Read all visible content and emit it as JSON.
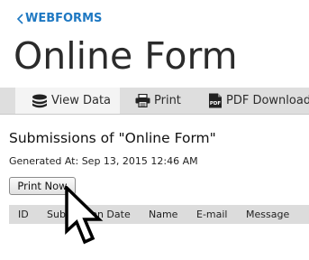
{
  "header": {
    "back_label": "WEBFORMS",
    "title": "Online Form"
  },
  "tabs": [
    {
      "label": "View Data",
      "icon": "database-icon",
      "active": true
    },
    {
      "label": "Print",
      "icon": "printer-icon",
      "active": false
    },
    {
      "label": "PDF Download",
      "icon": "pdf-icon",
      "active": false
    }
  ],
  "content": {
    "title": "Submissions of \"Online Form\"",
    "generated": "Generated At: Sep 13, 2015 12:46 AM",
    "print_button": "Print Now"
  },
  "table": {
    "columns": [
      "ID",
      "Submission Date",
      "Name",
      "E-mail",
      "Message"
    ]
  },
  "colors": {
    "accent": "#1e78c2",
    "tab_bar": "#dedede",
    "table_header": "#dcdcdc"
  }
}
